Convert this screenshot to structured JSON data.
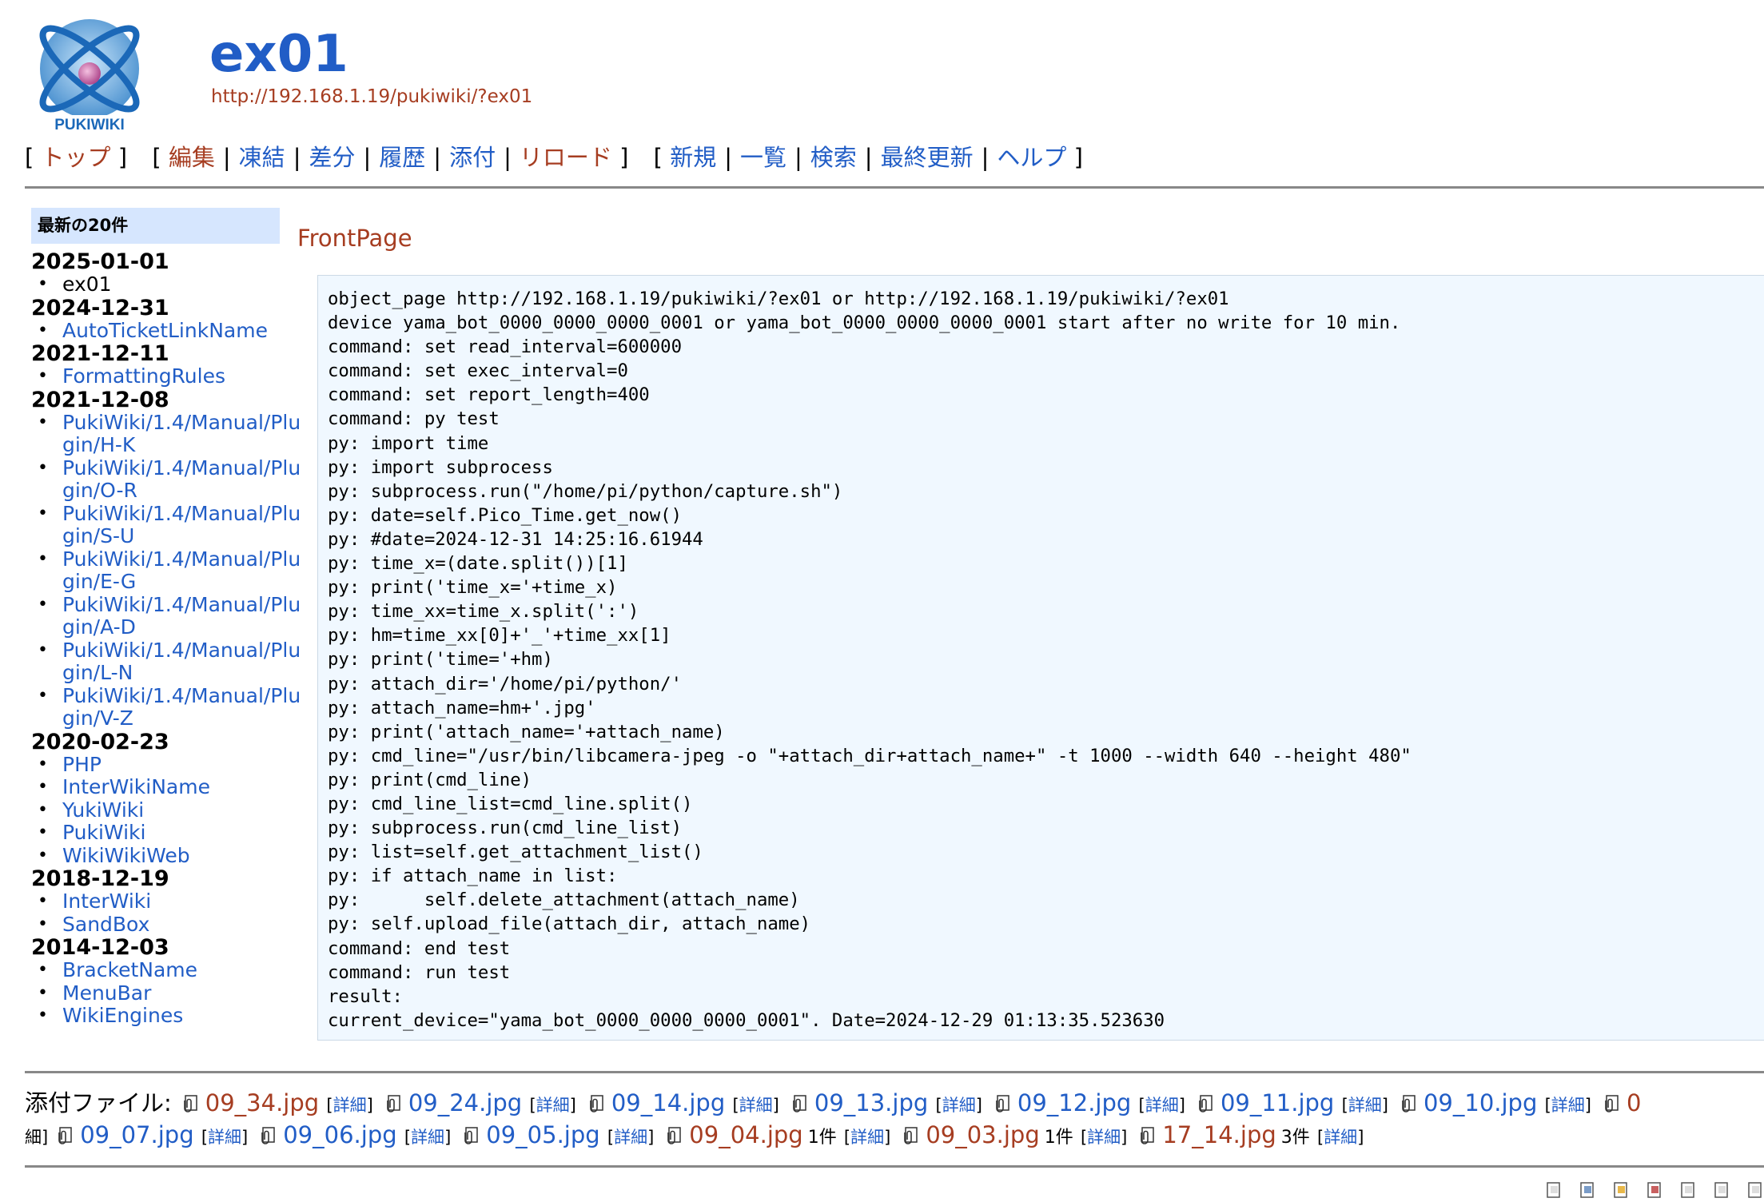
{
  "header": {
    "logo_text": "PUKIWIKI",
    "title": "ex01",
    "url": "http://192.168.1.19/pukiwiki/?ex01"
  },
  "navigator": {
    "group1": [
      "トップ"
    ],
    "group2": [
      "編集",
      "凍結",
      "差分",
      "履歴",
      "添付",
      "リロード"
    ],
    "group3": [
      "新規",
      "一覧",
      "検索",
      "最終更新",
      "ヘルプ"
    ]
  },
  "menubar": {
    "title": "最新の20件",
    "recent": [
      {
        "date": "2025-01-01",
        "items": [
          {
            "label": "ex01",
            "current": true
          }
        ]
      },
      {
        "date": "2024-12-31",
        "items": [
          {
            "label": "AutoTicketLinkName"
          }
        ]
      },
      {
        "date": "2021-12-11",
        "items": [
          {
            "label": "FormattingRules"
          }
        ]
      },
      {
        "date": "2021-12-08",
        "items": [
          {
            "label": "PukiWiki/1.4/Manual/Plugin/H-K"
          },
          {
            "label": "PukiWiki/1.4/Manual/Plugin/O-R"
          },
          {
            "label": "PukiWiki/1.4/Manual/Plugin/S-U"
          },
          {
            "label": "PukiWiki/1.4/Manual/Plugin/E-G"
          },
          {
            "label": "PukiWiki/1.4/Manual/Plugin/A-D"
          },
          {
            "label": "PukiWiki/1.4/Manual/Plugin/L-N"
          },
          {
            "label": "PukiWiki/1.4/Manual/Plugin/V-Z"
          }
        ]
      },
      {
        "date": "2020-02-23",
        "items": [
          {
            "label": "PHP"
          },
          {
            "label": "InterWikiName"
          },
          {
            "label": "YukiWiki"
          },
          {
            "label": "PukiWiki"
          },
          {
            "label": "WikiWikiWeb"
          }
        ]
      },
      {
        "date": "2018-12-19",
        "items": [
          {
            "label": "InterWiki"
          },
          {
            "label": "SandBox"
          }
        ]
      },
      {
        "date": "2014-12-03",
        "items": [
          {
            "label": "BracketName"
          },
          {
            "label": "MenuBar"
          },
          {
            "label": "WikiEngines"
          }
        ]
      }
    ]
  },
  "main": {
    "heading": "FrontPage",
    "code_lines": [
      "object_page http://192.168.1.19/pukiwiki/?ex01 or http://192.168.1.19/pukiwiki/?ex01",
      "device yama_bot_0000_0000_0000_0001 or yama_bot_0000_0000_0000_0001 start after no write for 10 min.",
      "command: set read_interval=600000",
      "command: set exec_interval=0",
      "command: set report_length=400",
      "command: py test",
      "py: import time",
      "py: import subprocess",
      "py: subprocess.run(\"/home/pi/python/capture.sh\")",
      "py: date=self.Pico_Time.get_now()",
      "py: #date=2024-12-31 14:25:16.61944",
      "py: time_x=(date.split())[1]",
      "py: print('time_x='+time_x)",
      "py: time_xx=time_x.split(':')",
      "py: hm=time_xx[0]+'_'+time_xx[1]",
      "py: print('time='+hm)",
      "py: attach_dir='/home/pi/python/'",
      "py: attach_name=hm+'.jpg'",
      "py: print('attach_name='+attach_name)",
      "py: cmd_line=\"/usr/bin/libcamera-jpeg -o \"+attach_dir+attach_name+\" -t 1000 --width 640 --height 480\"",
      "py: print(cmd_line)",
      "py: cmd_line_list=cmd_line.split()",
      "py: subprocess.run(cmd_line_list)",
      "py: list=self.get_attachment_list()",
      "py: if attach_name in list:",
      "py:      self.delete_attachment(attach_name)",
      "py: self.upload_file(attach_dir, attach_name)",
      "command: end test",
      "command: run test",
      "result:",
      "current_device=\"yama_bot_0000_0000_0000_0001\". Date=2024-12-29 01:13:35.523630"
    ]
  },
  "attachments": {
    "label": "添付ファイル:",
    "detail_label": "詳細",
    "row1": [
      {
        "name": "09_34.jpg",
        "visited": true,
        "count": ""
      },
      {
        "name": "09_24.jpg",
        "visited": false,
        "count": ""
      },
      {
        "name": "09_14.jpg",
        "visited": false,
        "count": ""
      },
      {
        "name": "09_13.jpg",
        "visited": false,
        "count": ""
      },
      {
        "name": "09_12.jpg",
        "visited": false,
        "count": ""
      },
      {
        "name": "09_11.jpg",
        "visited": false,
        "count": ""
      },
      {
        "name": "09_10.jpg",
        "visited": false,
        "count": ""
      }
    ],
    "row1_tail": "0",
    "row2_head": "細]",
    "row2": [
      {
        "name": "09_07.jpg",
        "visited": false,
        "count": ""
      },
      {
        "name": "09_06.jpg",
        "visited": false,
        "count": ""
      },
      {
        "name": "09_05.jpg",
        "visited": false,
        "count": ""
      },
      {
        "name": "09_04.jpg",
        "visited": true,
        "count": "1件"
      },
      {
        "name": "09_03.jpg",
        "visited": true,
        "count": "1件"
      },
      {
        "name": "17_14.jpg",
        "visited": true,
        "count": "3件"
      }
    ]
  },
  "colors": {
    "link": "#215dc6",
    "visited": "#a63d21",
    "menu_title_bg": "#d6e6fe",
    "code_bg": "#f0f8ff"
  }
}
